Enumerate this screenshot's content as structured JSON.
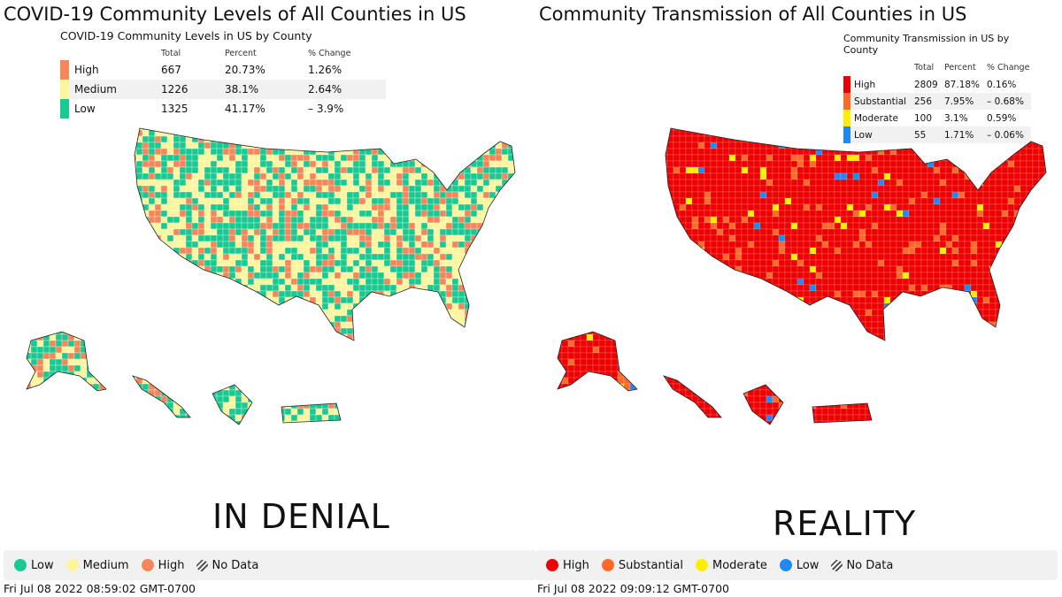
{
  "left": {
    "title": "COVID-19 Community Levels of All Counties in US",
    "table": {
      "caption": "COVID-19 Community Levels in US by County",
      "headers": [
        "",
        "Total",
        "Percent",
        "% Change"
      ],
      "rows": [
        {
          "label": "High",
          "total": "667",
          "percent": "20.73%",
          "change": "1.26%",
          "color": "#f4875a"
        },
        {
          "label": "Medium",
          "total": "1226",
          "percent": "38.1%",
          "change": "2.64%",
          "color": "#fbf69b"
        },
        {
          "label": "Low",
          "total": "1325",
          "percent": "41.17%",
          "change": "– 3.9%",
          "color": "#19c991"
        }
      ]
    },
    "caption": "IN DENIAL",
    "legend": [
      {
        "label": "Low",
        "color": "#19c991"
      },
      {
        "label": "Medium",
        "color": "#fbf69b"
      },
      {
        "label": "High",
        "color": "#f4875a"
      },
      {
        "label": "No Data",
        "icon": "hatch-icon"
      }
    ],
    "timestamp": "Fri Jul 08 2022 08:59:02 GMT-0700"
  },
  "right": {
    "title": "Community Transmission of All Counties in US",
    "table": {
      "caption": "Community Transmission in US by County",
      "headers": [
        "",
        "Total",
        "Percent",
        "% Change"
      ],
      "rows": [
        {
          "label": "High",
          "total": "2809",
          "percent": "87.18%",
          "change": "0.16%",
          "color": "#ee0000"
        },
        {
          "label": "Substantial",
          "total": "256",
          "percent": "7.95%",
          "change": "– 0.68%",
          "color": "#ff6a2b"
        },
        {
          "label": "Moderate",
          "total": "100",
          "percent": "3.1%",
          "change": "0.59%",
          "color": "#ffee00"
        },
        {
          "label": "Low",
          "total": "55",
          "percent": "1.71%",
          "change": "– 0.06%",
          "color": "#1f8af5"
        }
      ]
    },
    "caption": "REALITY",
    "legend": [
      {
        "label": "High",
        "color": "#ee0000"
      },
      {
        "label": "Substantial",
        "color": "#ff6a2b"
      },
      {
        "label": "Moderate",
        "color": "#ffee00"
      },
      {
        "label": "Low",
        "color": "#1f8af5"
      },
      {
        "label": "No Data",
        "icon": "hatch-icon"
      }
    ],
    "timestamp": "Fri Jul 08 2022 09:09:12 GMT-0700"
  }
}
